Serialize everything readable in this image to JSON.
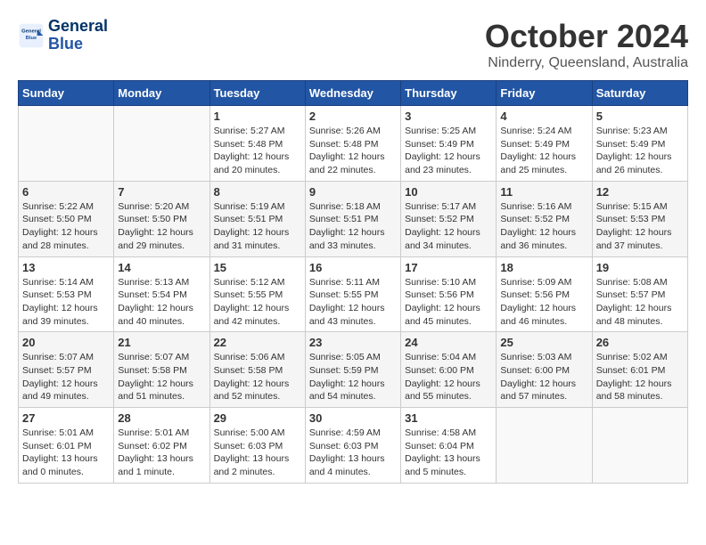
{
  "header": {
    "logo_line1": "General",
    "logo_line2": "Blue",
    "month": "October 2024",
    "location": "Ninderry, Queensland, Australia"
  },
  "weekdays": [
    "Sunday",
    "Monday",
    "Tuesday",
    "Wednesday",
    "Thursday",
    "Friday",
    "Saturday"
  ],
  "weeks": [
    [
      {
        "day": "",
        "info": ""
      },
      {
        "day": "",
        "info": ""
      },
      {
        "day": "1",
        "info": "Sunrise: 5:27 AM\nSunset: 5:48 PM\nDaylight: 12 hours and 20 minutes."
      },
      {
        "day": "2",
        "info": "Sunrise: 5:26 AM\nSunset: 5:48 PM\nDaylight: 12 hours and 22 minutes."
      },
      {
        "day": "3",
        "info": "Sunrise: 5:25 AM\nSunset: 5:49 PM\nDaylight: 12 hours and 23 minutes."
      },
      {
        "day": "4",
        "info": "Sunrise: 5:24 AM\nSunset: 5:49 PM\nDaylight: 12 hours and 25 minutes."
      },
      {
        "day": "5",
        "info": "Sunrise: 5:23 AM\nSunset: 5:49 PM\nDaylight: 12 hours and 26 minutes."
      }
    ],
    [
      {
        "day": "6",
        "info": "Sunrise: 5:22 AM\nSunset: 5:50 PM\nDaylight: 12 hours and 28 minutes."
      },
      {
        "day": "7",
        "info": "Sunrise: 5:20 AM\nSunset: 5:50 PM\nDaylight: 12 hours and 29 minutes."
      },
      {
        "day": "8",
        "info": "Sunrise: 5:19 AM\nSunset: 5:51 PM\nDaylight: 12 hours and 31 minutes."
      },
      {
        "day": "9",
        "info": "Sunrise: 5:18 AM\nSunset: 5:51 PM\nDaylight: 12 hours and 33 minutes."
      },
      {
        "day": "10",
        "info": "Sunrise: 5:17 AM\nSunset: 5:52 PM\nDaylight: 12 hours and 34 minutes."
      },
      {
        "day": "11",
        "info": "Sunrise: 5:16 AM\nSunset: 5:52 PM\nDaylight: 12 hours and 36 minutes."
      },
      {
        "day": "12",
        "info": "Sunrise: 5:15 AM\nSunset: 5:53 PM\nDaylight: 12 hours and 37 minutes."
      }
    ],
    [
      {
        "day": "13",
        "info": "Sunrise: 5:14 AM\nSunset: 5:53 PM\nDaylight: 12 hours and 39 minutes."
      },
      {
        "day": "14",
        "info": "Sunrise: 5:13 AM\nSunset: 5:54 PM\nDaylight: 12 hours and 40 minutes."
      },
      {
        "day": "15",
        "info": "Sunrise: 5:12 AM\nSunset: 5:55 PM\nDaylight: 12 hours and 42 minutes."
      },
      {
        "day": "16",
        "info": "Sunrise: 5:11 AM\nSunset: 5:55 PM\nDaylight: 12 hours and 43 minutes."
      },
      {
        "day": "17",
        "info": "Sunrise: 5:10 AM\nSunset: 5:56 PM\nDaylight: 12 hours and 45 minutes."
      },
      {
        "day": "18",
        "info": "Sunrise: 5:09 AM\nSunset: 5:56 PM\nDaylight: 12 hours and 46 minutes."
      },
      {
        "day": "19",
        "info": "Sunrise: 5:08 AM\nSunset: 5:57 PM\nDaylight: 12 hours and 48 minutes."
      }
    ],
    [
      {
        "day": "20",
        "info": "Sunrise: 5:07 AM\nSunset: 5:57 PM\nDaylight: 12 hours and 49 minutes."
      },
      {
        "day": "21",
        "info": "Sunrise: 5:07 AM\nSunset: 5:58 PM\nDaylight: 12 hours and 51 minutes."
      },
      {
        "day": "22",
        "info": "Sunrise: 5:06 AM\nSunset: 5:58 PM\nDaylight: 12 hours and 52 minutes."
      },
      {
        "day": "23",
        "info": "Sunrise: 5:05 AM\nSunset: 5:59 PM\nDaylight: 12 hours and 54 minutes."
      },
      {
        "day": "24",
        "info": "Sunrise: 5:04 AM\nSunset: 6:00 PM\nDaylight: 12 hours and 55 minutes."
      },
      {
        "day": "25",
        "info": "Sunrise: 5:03 AM\nSunset: 6:00 PM\nDaylight: 12 hours and 57 minutes."
      },
      {
        "day": "26",
        "info": "Sunrise: 5:02 AM\nSunset: 6:01 PM\nDaylight: 12 hours and 58 minutes."
      }
    ],
    [
      {
        "day": "27",
        "info": "Sunrise: 5:01 AM\nSunset: 6:01 PM\nDaylight: 13 hours and 0 minutes."
      },
      {
        "day": "28",
        "info": "Sunrise: 5:01 AM\nSunset: 6:02 PM\nDaylight: 13 hours and 1 minute."
      },
      {
        "day": "29",
        "info": "Sunrise: 5:00 AM\nSunset: 6:03 PM\nDaylight: 13 hours and 2 minutes."
      },
      {
        "day": "30",
        "info": "Sunrise: 4:59 AM\nSunset: 6:03 PM\nDaylight: 13 hours and 4 minutes."
      },
      {
        "day": "31",
        "info": "Sunrise: 4:58 AM\nSunset: 6:04 PM\nDaylight: 13 hours and 5 minutes."
      },
      {
        "day": "",
        "info": ""
      },
      {
        "day": "",
        "info": ""
      }
    ]
  ]
}
